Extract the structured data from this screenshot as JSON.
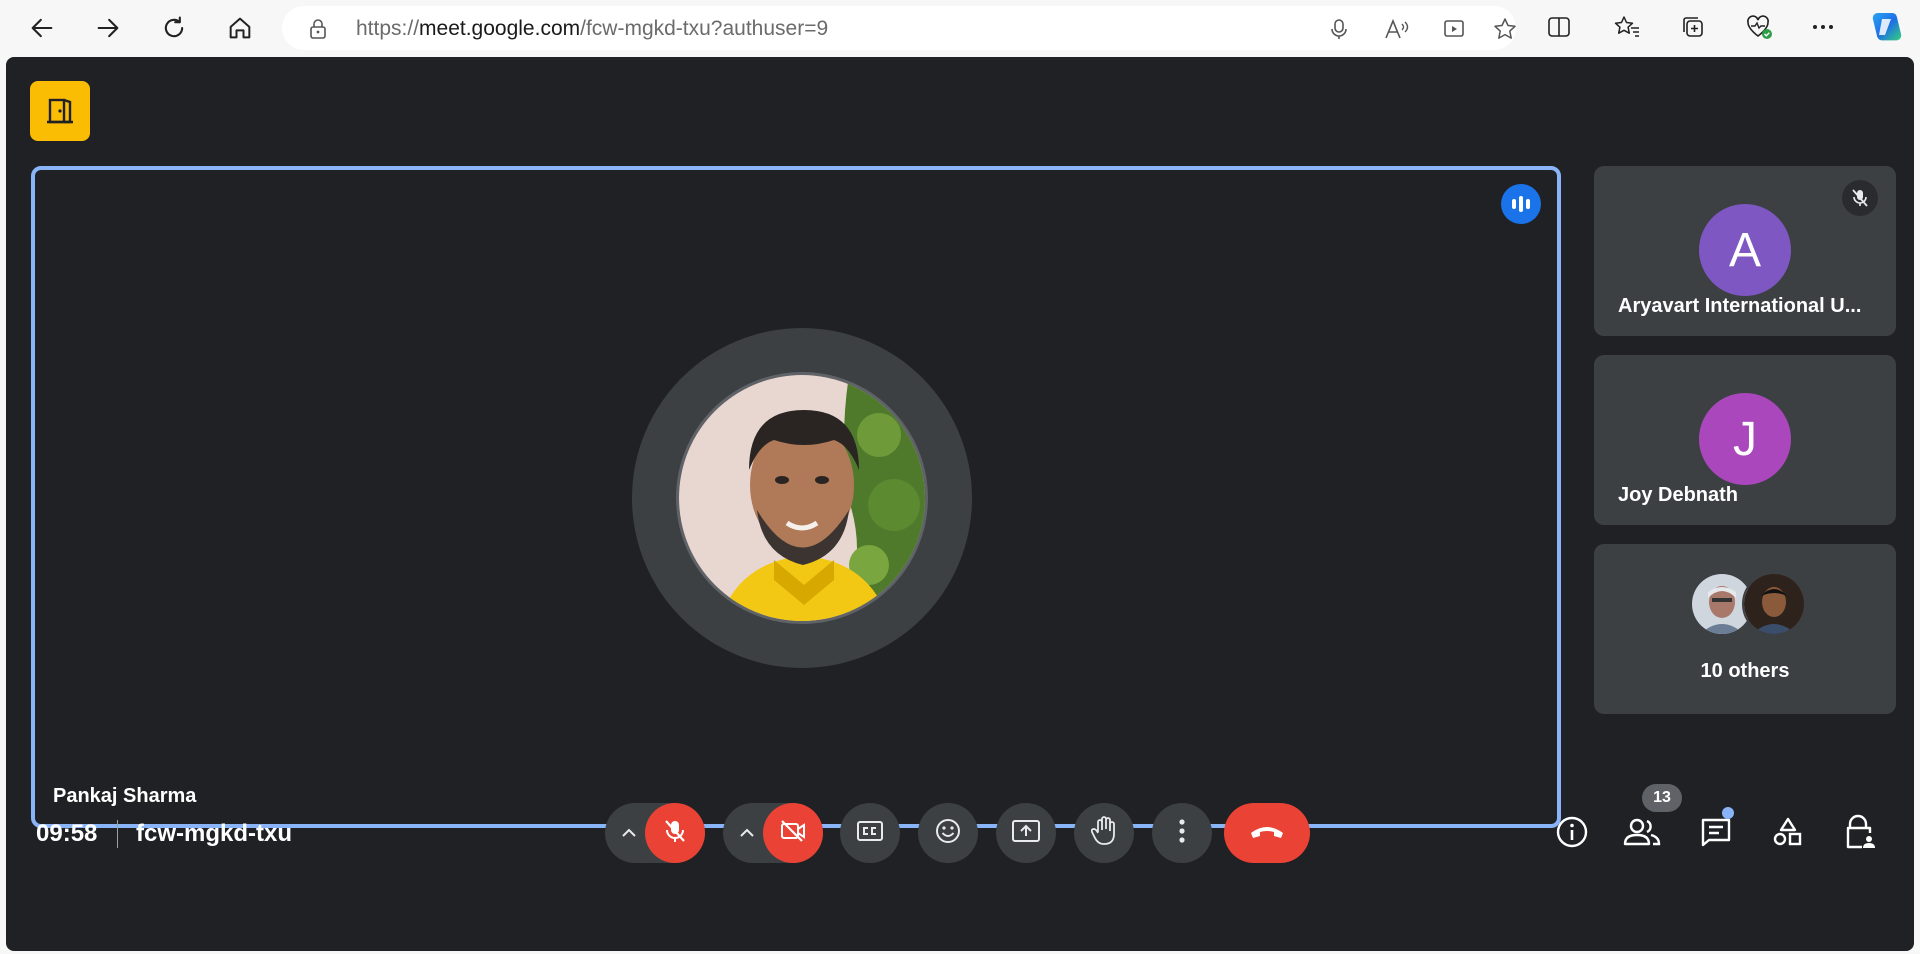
{
  "browser": {
    "url_prefix": "https://",
    "url_host": "meet.google.com",
    "url_path": "/fcw-mgkd-txu?authuser=9"
  },
  "meeting": {
    "time": "09:58",
    "code": "fcw-mgkd-txu",
    "participant_count": "13"
  },
  "main_tile": {
    "name": "Pankaj Sharma"
  },
  "side_tiles": [
    {
      "initial": "A",
      "name": "Aryavart International U...",
      "color": "#7e57c2"
    },
    {
      "initial": "J",
      "name": "Joy Debnath",
      "color": "#ab47bc"
    }
  ],
  "others": {
    "label": "10 others"
  },
  "colors": {
    "accent": "#8ab4f8",
    "end_call": "#ea4335",
    "leave_button": "#fbbc04",
    "background": "#202124"
  },
  "icons": {
    "leave": "door-icon",
    "speaking": "audio-level-icon",
    "mic_off": "mic-off-icon",
    "cam_off": "videocam-off-icon",
    "captions": "closed-caption-icon",
    "emoji": "emoji-icon",
    "present": "present-screen-icon",
    "raise_hand": "hand-icon",
    "more": "more-vert-icon",
    "end": "call-end-icon",
    "info": "info-icon",
    "people": "people-icon",
    "chat": "chat-icon",
    "activities": "shapes-icon",
    "host_controls": "lock-person-icon"
  }
}
